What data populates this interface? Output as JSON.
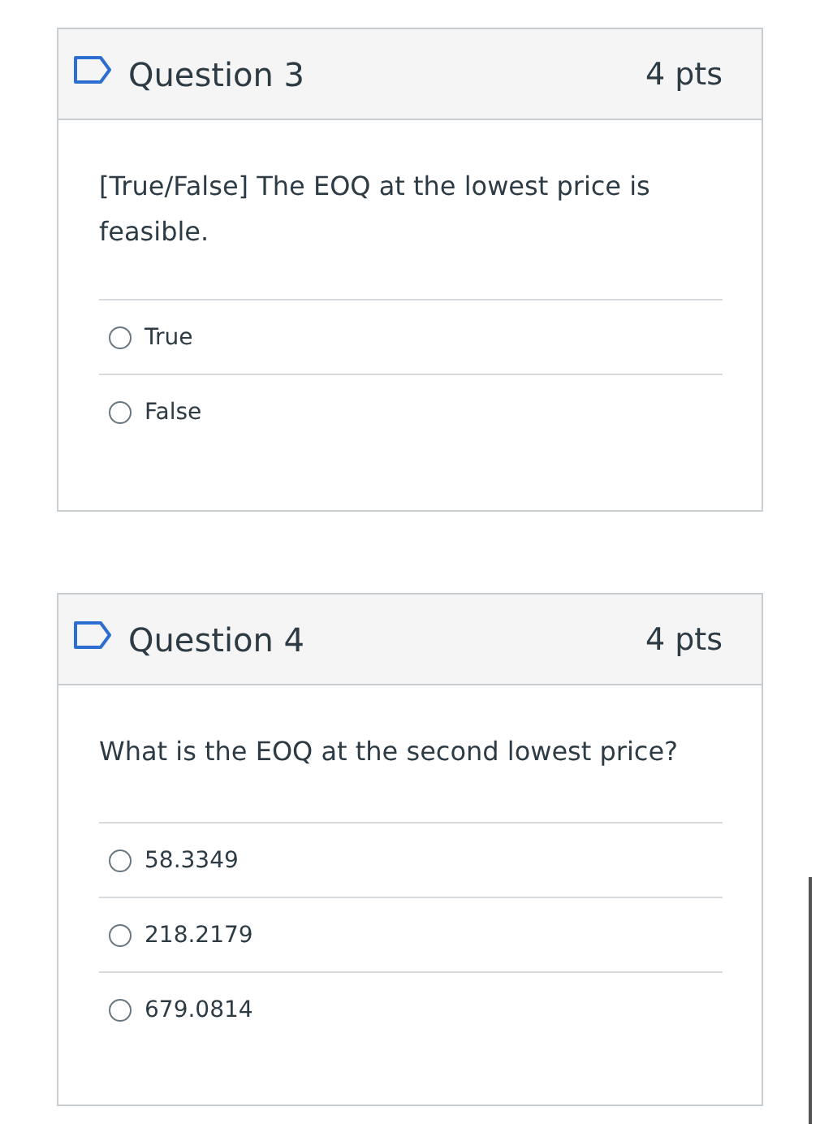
{
  "questions": [
    {
      "title": "Question 3",
      "points": "4 pts",
      "text": "[True/False] The EOQ at the lowest price is feasible.",
      "answers": [
        {
          "label": "True",
          "selected": false
        },
        {
          "label": "False",
          "selected": false
        }
      ]
    },
    {
      "title": "Question 4",
      "points": "4 pts",
      "text": "What is the EOQ at the second lowest price?",
      "answers": [
        {
          "label": "58.3349",
          "selected": false
        },
        {
          "label": "218.2179",
          "selected": false
        },
        {
          "label": "679.0814",
          "selected": false
        }
      ]
    }
  ]
}
